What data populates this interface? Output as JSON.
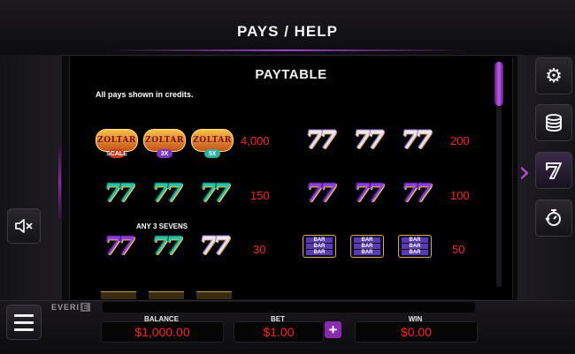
{
  "header": {
    "title": "PAYS / HELP"
  },
  "paytable": {
    "heading": "PAYTABLE",
    "note": "All pays shown in credits.",
    "any_label": "ANY 3 SEVENS",
    "rows": [
      {
        "left_pay": "4,000",
        "right_pay": "200"
      },
      {
        "left_pay": "150",
        "right_pay": "100"
      },
      {
        "left_pay": "30",
        "right_pay": "50"
      }
    ],
    "logo_text": "ZOLTAR",
    "logo_badges": [
      "SCALE",
      "3X",
      "5X"
    ],
    "seven_glyph": "7",
    "bar_text": "BAR"
  },
  "meters": {
    "balance_label": "BALANCE",
    "balance_value": "$1,000.00",
    "bet_label": "BET",
    "bet_value": "$1.00",
    "win_label": "WIN",
    "win_value": "$0.00",
    "plus_label": "+"
  },
  "brand": {
    "text": "EVERI",
    "badge": "E"
  },
  "icons": {
    "settings": "gear-icon",
    "coins": "coins-stack-icon",
    "paytable": "seven-icon",
    "timer": "stopwatch-icon",
    "mute": "speaker-mute-icon",
    "menu": "hamburger-menu-icon"
  },
  "colors": {
    "accent": "#a040d0",
    "pay_red": "#ff2020",
    "purple_seven": "#8c3fe0",
    "teal_seven": "#27c1a8"
  }
}
